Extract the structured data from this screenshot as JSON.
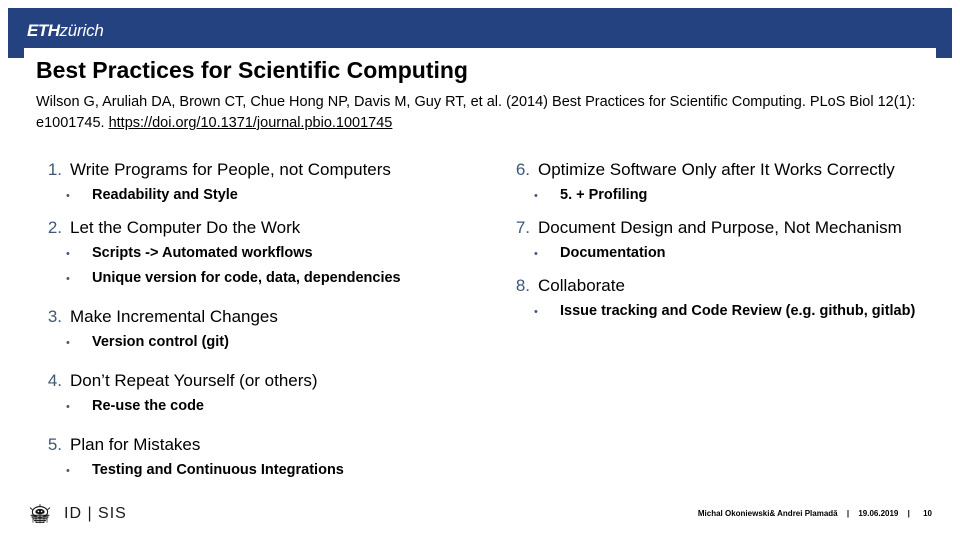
{
  "header": {
    "logo_mark": "ETH",
    "logo_city": "zürich",
    "accent_color": "#24427f"
  },
  "title": "Best Practices for Scientific Computing",
  "citation": {
    "text": "Wilson G, Aruliah DA, Brown CT, Chue Hong NP, Davis M, Guy RT, et al. (2014) Best Practices for Scientific Computing. PLoS Biol 12(1): e1001745. ",
    "link": "https://doi.org/10.1371/journal.pbio.1001745"
  },
  "left_column": [
    {
      "number": "1.",
      "text": "Write Programs for People, not Computers",
      "subs": [
        "Readability and Style"
      ]
    },
    {
      "number": "2.",
      "text": "Let the Computer Do the Work",
      "subs": [
        "Scripts -> Automated workflows",
        "Unique version for code, data, dependencies"
      ]
    },
    {
      "number": "3.",
      "text": "Make Incremental Changes",
      "subs": [
        "Version control (git)"
      ]
    },
    {
      "number": "4.",
      "text": "Don’t Repeat Yourself (or others)",
      "subs": [
        "Re-use the code"
      ]
    },
    {
      "number": "5.",
      "text": "Plan for Mistakes",
      "subs": [
        "Testing and Continuous Integrations"
      ]
    }
  ],
  "right_column": [
    {
      "number": "6.",
      "text": "Optimize Software Only after It Works Correctly",
      "subs": [
        "5. + Profiling"
      ]
    },
    {
      "number": "7.",
      "text": "Document Design and Purpose, Not Mechanism",
      "subs": [
        "Documentation"
      ]
    },
    {
      "number": "8.",
      "text": "Collaborate",
      "subs": [
        "Issue tracking and Code Review (e.g. github, gitlab)"
      ]
    }
  ],
  "footer": {
    "department": "ID | SIS",
    "authors": "Michal Okoniewski& Andrei Plamadă",
    "separator": "|",
    "date": "19.06.2019",
    "page": "10"
  }
}
